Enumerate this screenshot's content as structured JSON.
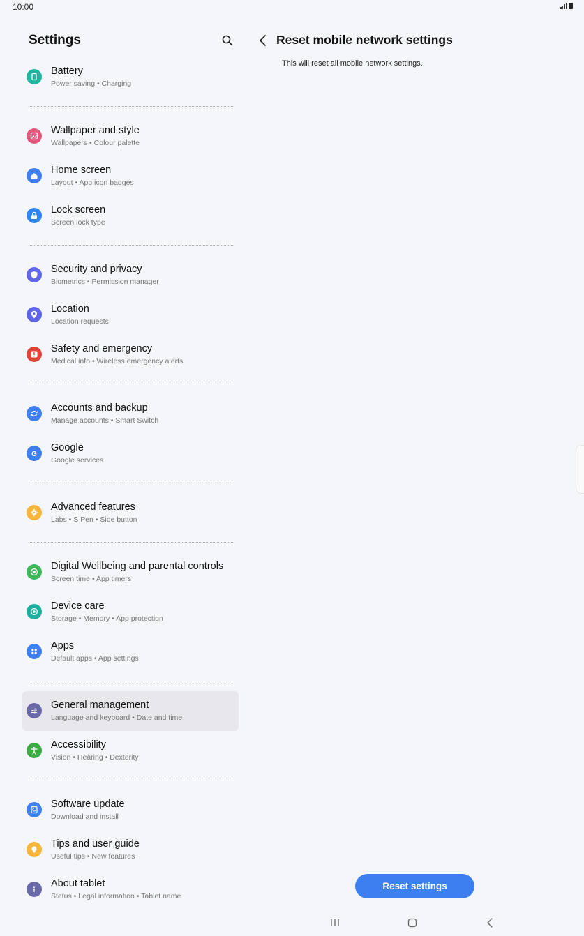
{
  "status": {
    "time": "10:00"
  },
  "left": {
    "title": "Settings",
    "groups": [
      [
        {
          "name": "battery",
          "title": "Battery",
          "sub": "Power saving  •  Charging",
          "icon": "battery-icon",
          "color": "#21b5a0"
        }
      ],
      [
        {
          "name": "wallpaper",
          "title": "Wallpaper and style",
          "sub": "Wallpapers  •  Colour palette",
          "icon": "wallpaper-icon",
          "color": "#e6577d"
        },
        {
          "name": "home-screen",
          "title": "Home screen",
          "sub": "Layout  •  App icon badges",
          "icon": "home-icon",
          "color": "#3f7ff0"
        },
        {
          "name": "lock-screen",
          "title": "Lock screen",
          "sub": "Screen lock type",
          "icon": "lock-icon",
          "color": "#2f86f3"
        }
      ],
      [
        {
          "name": "security",
          "title": "Security and privacy",
          "sub": "Biometrics  •  Permission manager",
          "icon": "shield-icon",
          "color": "#6166e8"
        },
        {
          "name": "location",
          "title": "Location",
          "sub": "Location requests",
          "icon": "location-pin-icon",
          "color": "#6166e8"
        },
        {
          "name": "safety",
          "title": "Safety and emergency",
          "sub": "Medical info  •  Wireless emergency alerts",
          "icon": "emergency-icon",
          "color": "#e0453a"
        }
      ],
      [
        {
          "name": "accounts",
          "title": "Accounts and backup",
          "sub": "Manage accounts  •  Smart Switch",
          "icon": "sync-icon",
          "color": "#3f7ff0"
        },
        {
          "name": "google",
          "title": "Google",
          "sub": "Google services",
          "icon": "google-icon",
          "color": "#3f7ff0"
        }
      ],
      [
        {
          "name": "advanced",
          "title": "Advanced features",
          "sub": "Labs  •  S Pen  •  Side button",
          "icon": "gear-plus-icon",
          "color": "#f5b63b"
        }
      ],
      [
        {
          "name": "wellbeing",
          "title": "Digital Wellbeing and parental controls",
          "sub": "Screen time  •  App timers",
          "icon": "heart-circle-icon",
          "color": "#3eb85a"
        },
        {
          "name": "device-care",
          "title": "Device care",
          "sub": "Storage  •  Memory  •  App protection",
          "icon": "device-care-icon",
          "color": "#1fb0a2"
        },
        {
          "name": "apps",
          "title": "Apps",
          "sub": "Default apps  •  App settings",
          "icon": "apps-grid-icon",
          "color": "#3f7ff0"
        }
      ],
      [
        {
          "name": "general-management",
          "title": "General management",
          "sub": "Language and keyboard  •  Date and time",
          "icon": "sliders-icon",
          "color": "#6a6aa8",
          "selected": true
        },
        {
          "name": "accessibility",
          "title": "Accessibility",
          "sub": "Vision  •  Hearing  •  Dexterity",
          "icon": "accessibility-icon",
          "color": "#3eaa45"
        }
      ],
      [
        {
          "name": "software-update",
          "title": "Software update",
          "sub": "Download and install",
          "icon": "update-icon",
          "color": "#3f7ff0"
        },
        {
          "name": "tips",
          "title": "Tips and user guide",
          "sub": "Useful tips  •  New features",
          "icon": "lightbulb-icon",
          "color": "#f5b63b"
        },
        {
          "name": "about",
          "title": "About tablet",
          "sub": "Status  •  Legal information  •  Tablet name",
          "icon": "info-icon",
          "color": "#6a6aa8"
        }
      ]
    ]
  },
  "right": {
    "title": "Reset mobile network settings",
    "description": "This will reset all mobile network settings.",
    "button_label": "Reset settings"
  }
}
